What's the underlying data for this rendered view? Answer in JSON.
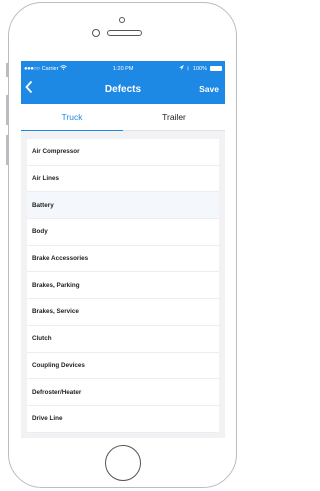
{
  "status_bar": {
    "carrier": "Carrier",
    "time": "1:20 PM",
    "battery": "100%"
  },
  "nav": {
    "title": "Defects",
    "save_label": "Save",
    "back_icon": "chevron-left-icon"
  },
  "tabs": [
    {
      "label": "Truck",
      "active": true
    },
    {
      "label": "Trailer",
      "active": false
    }
  ],
  "defects": [
    {
      "label": "Air Compressor"
    },
    {
      "label": "Air Lines"
    },
    {
      "label": "Battery"
    },
    {
      "label": "Body"
    },
    {
      "label": "Brake Accessories"
    },
    {
      "label": "Brakes, Parking"
    },
    {
      "label": "Brakes, Service"
    },
    {
      "label": "Clutch"
    },
    {
      "label": "Coupling Devices"
    },
    {
      "label": "Defroster/Heater"
    },
    {
      "label": "Drive Line"
    }
  ],
  "colors": {
    "accent": "#1e88e5",
    "list_bg": "#ffffff",
    "screen_bg": "#f2f2f4"
  }
}
